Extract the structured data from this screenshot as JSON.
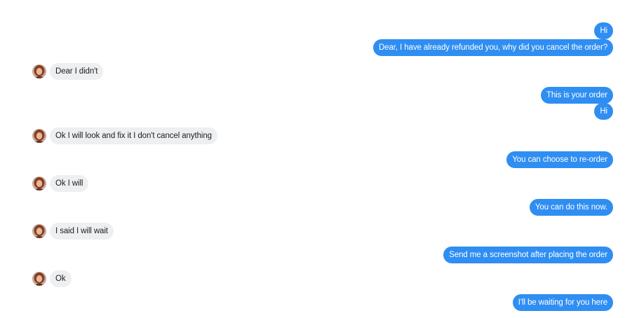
{
  "colors": {
    "outgoing_bubble": "#2f8ef2",
    "incoming_bubble": "#eeeff1"
  },
  "messages": [
    {
      "direction": "out",
      "text": "Hi"
    },
    {
      "direction": "out",
      "text": "Dear, I have already refunded you, why did you cancel the order?"
    },
    {
      "direction": "in",
      "text": "Dear I didn't"
    },
    {
      "direction": "out",
      "text": "This is your order"
    },
    {
      "direction": "out",
      "text": "Hi"
    },
    {
      "direction": "in",
      "text": "Ok I will look and fix it I don't cancel anything"
    },
    {
      "direction": "out",
      "text": "You can choose to re-order"
    },
    {
      "direction": "in",
      "text": "Ok I will"
    },
    {
      "direction": "out",
      "text": "You can do this now."
    },
    {
      "direction": "in",
      "text": "I said I will wait"
    },
    {
      "direction": "out",
      "text": "Send me a screenshot after placing the order"
    },
    {
      "direction": "in",
      "text": "Ok"
    },
    {
      "direction": "out",
      "text": "I'll be waiting for you here"
    }
  ],
  "avatar_icon": "user-avatar-icon"
}
